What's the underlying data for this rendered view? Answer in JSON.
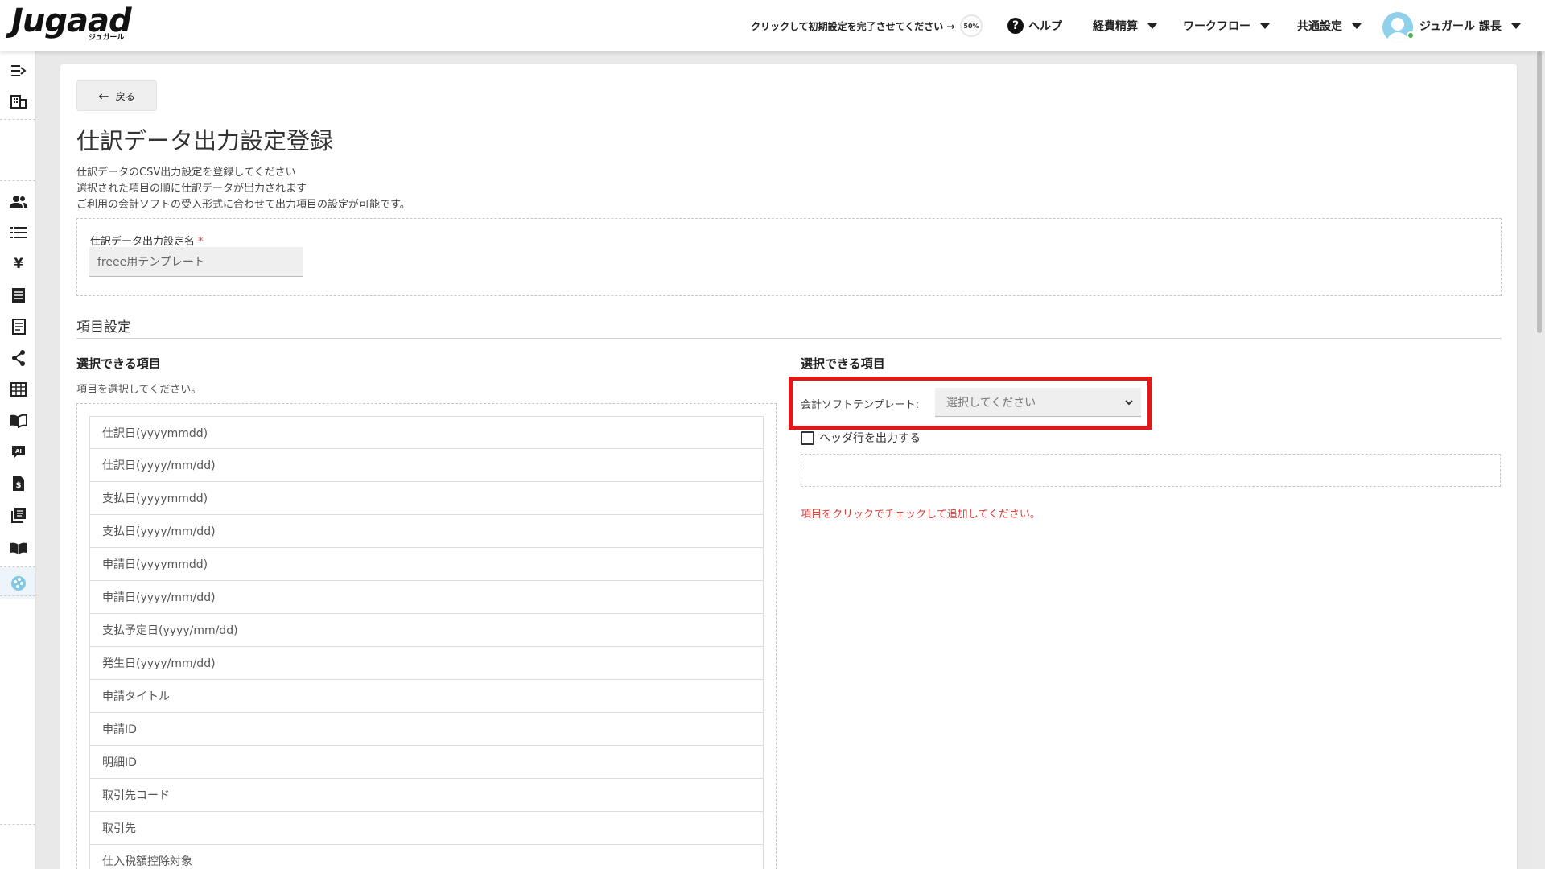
{
  "header": {
    "logo_text": "Jugaad",
    "logo_sub": "ジュガール",
    "setup_link": "クリックして初期設定を完了させてください →",
    "setup_progress": "50%",
    "nav": {
      "help": "ヘルプ",
      "expense": "経費精算",
      "workflow": "ワークフロー",
      "common": "共通設定"
    },
    "user_name": "ジュガール 課長"
  },
  "sidebar": {
    "icons": [
      "sidebar-toggle-icon",
      "building-icon",
      "users-icon",
      "list-icon",
      "yen-icon",
      "document-icon",
      "receipt-icon",
      "share-icon",
      "grid-icon",
      "book-icon",
      "ai-chat-icon",
      "invoice-icon",
      "stack-icon",
      "manual-icon",
      "palette-icon"
    ]
  },
  "page": {
    "back_label": "戻る",
    "title": "仕訳データ出力設定登録",
    "descriptions": [
      "仕訳データのCSV出力設定を登録してください",
      "選択された項目の順に仕訳データが出力されます",
      "ご利用の会計ソフトの受入形式に合わせて出力項目の設定が可能です。"
    ],
    "name_field": {
      "label": "仕訳データ出力設定名",
      "required_mark": "*",
      "placeholder": "freee用テンプレート"
    },
    "section_title": "項目設定",
    "left": {
      "title": "選択できる項目",
      "hint": "項目を選択してください。",
      "items": [
        "仕訳日(yyyymmdd)",
        "仕訳日(yyyy/mm/dd)",
        "支払日(yyyymmdd)",
        "支払日(yyyy/mm/dd)",
        "申請日(yyyymmdd)",
        "申請日(yyyy/mm/dd)",
        "支払予定日(yyyy/mm/dd)",
        "発生日(yyyy/mm/dd)",
        "申請タイトル",
        "申請ID",
        "明細ID",
        "取引先コード",
        "取引先",
        "仕入税額控除対象"
      ]
    },
    "right": {
      "title": "選択できる項目",
      "template_label": "会計ソフトテンプレート:",
      "template_placeholder": "選択してください",
      "header_checkbox": "ヘッダ行を出力する",
      "error": "項目をクリックでチェックして追加してください。"
    }
  },
  "colors": {
    "highlight": "#e01818",
    "error": "#e53935",
    "online": "#4caf50"
  }
}
